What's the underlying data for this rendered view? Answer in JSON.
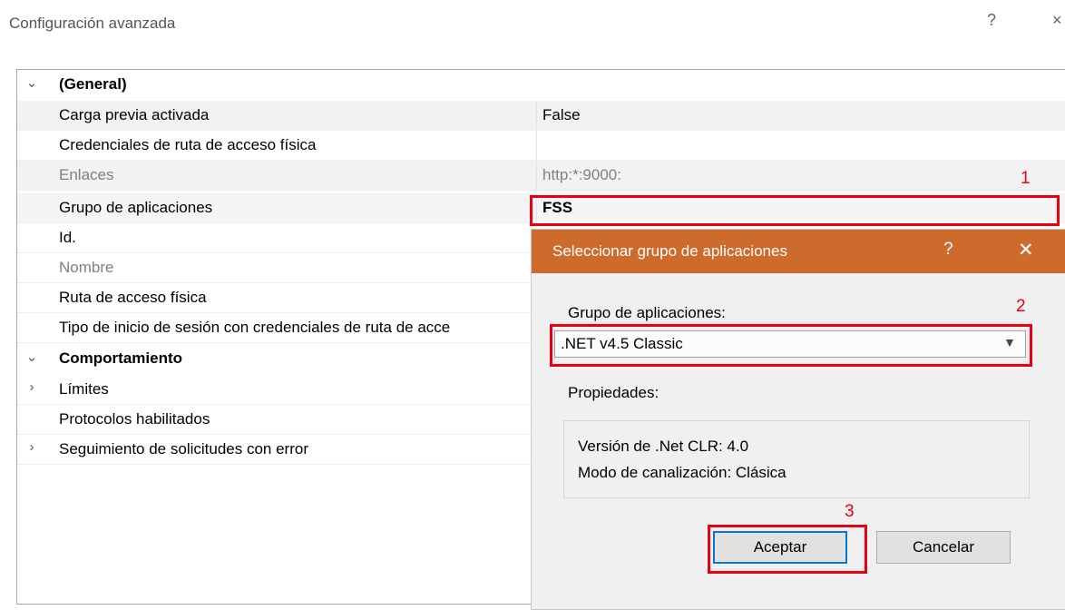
{
  "window": {
    "title": "Configuración avanzada",
    "help": "?",
    "close": "×"
  },
  "grid": {
    "section_general": "(General)",
    "rows_general": [
      {
        "name": "Carga previa activada",
        "value": "False"
      },
      {
        "name": "Credenciales de ruta de acceso física",
        "value": ""
      },
      {
        "name": "Enlaces",
        "value": "http:*:9000:"
      },
      {
        "name": "Grupo de aplicaciones",
        "value": "FSS"
      },
      {
        "name": "Id.",
        "value": ""
      },
      {
        "name": "Nombre",
        "value": ""
      },
      {
        "name": "Ruta de acceso física",
        "value": ""
      },
      {
        "name": "Tipo de inicio de sesión con credenciales de ruta de acce",
        "value": ""
      }
    ],
    "section_behavior": "Comportamiento",
    "rows_behavior": [
      {
        "name": "Límites"
      },
      {
        "name": "Protocolos habilitados"
      },
      {
        "name": "Seguimiento de solicitudes con error"
      }
    ]
  },
  "annotations": {
    "one": "1",
    "two": "2",
    "three": "3"
  },
  "dialog": {
    "title": "Seleccionar grupo de aplicaciones",
    "help": "?",
    "close": "✕",
    "pool_label": "Grupo de aplicaciones:",
    "pool_value": ".NET v4.5 Classic",
    "properties_label": "Propiedades:",
    "clr_version": "Versión de .Net CLR: 4.0",
    "pipeline_mode": "Modo de canalización: Clásica",
    "ok_label": "Aceptar",
    "cancel_label": "Cancelar"
  },
  "colors": {
    "dialog_title_bar": "#cc6b2c",
    "annotation_red": "#e60012",
    "default_button_border": "#0078d7"
  }
}
